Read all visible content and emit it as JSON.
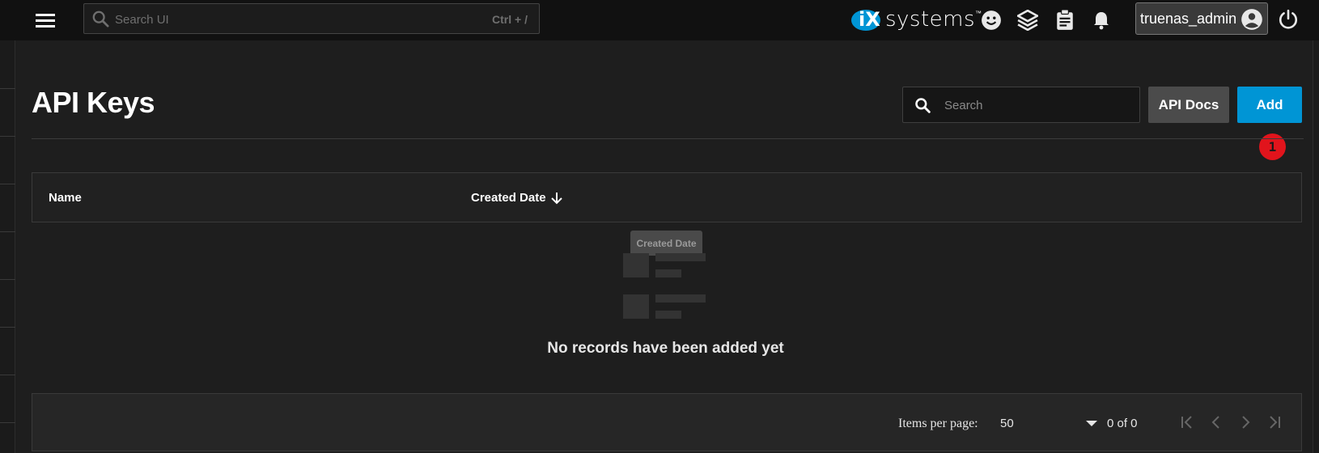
{
  "topbar": {
    "search_placeholder": "Search UI",
    "search_shortcut": "Ctrl + /",
    "logo_ix": "iX",
    "logo_text": "systems",
    "logo_tm": "™",
    "username": "truenas_admin",
    "icons": [
      "menu-icon",
      "feedback-icon",
      "truecommand-icon",
      "jobs-icon",
      "notifications-icon",
      "user-icon",
      "power-icon"
    ]
  },
  "page": {
    "title": "API Keys",
    "search_placeholder": "Search",
    "api_docs_label": "API Docs",
    "add_label": "Add",
    "step_badge": "1"
  },
  "table": {
    "columns": [
      "Name",
      "Created Date"
    ],
    "sort_column": "Created Date",
    "sort_direction": "descending",
    "tooltip": "Created Date",
    "empty_message": "No records have been added yet"
  },
  "paginator": {
    "items_per_page_label": "Items per page:",
    "items_per_page_value": "50",
    "range_label": "0 of 0"
  },
  "colors": {
    "topbar": "#111111",
    "background": "#1e1e1e",
    "accent": "#0095d5",
    "secondary_button": "#4b4b4b",
    "badge": "#e1141c",
    "logo_blue": "#0095d5"
  }
}
